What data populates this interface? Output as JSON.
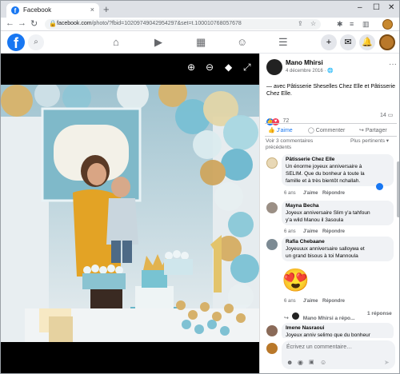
{
  "browser": {
    "tab_title": "Facebook",
    "tab_close": "×",
    "new_tab": "+",
    "url_host": "facebook.com",
    "url_path": "/photo/?fbid=1020974904295429​7&set=t.100010768057678",
    "win_min": "–",
    "win_max": "☐",
    "win_close": "✕",
    "back": "←",
    "forward": "→",
    "reload": "↻"
  },
  "fb": {
    "logo": "f",
    "search_icon": "search-icon",
    "plus": "+"
  },
  "post": {
    "author": "Mano Mhirsi",
    "date": "4 décembre 2016 · ",
    "body": "— avec Pâtisserie Sheselles Chez Elle et Pâtisserie Chez Elle.",
    "reaction_count": "72",
    "comment_count": "14",
    "like_label": "J'aime",
    "comment_label": "Commenter",
    "share_label": "Partager",
    "see_previous": "Voir 3 commentaires précédents",
    "sort_label": "Plus pertinents ▾"
  },
  "comments": [
    {
      "name": "Pâtisserie Chez Elle",
      "lines": [
        "Un énorme joyeux anniversaire à",
        "SELIM. Que du bonheur à toute la",
        "famille et à très bientôt nchallah."
      ],
      "age": "6 ans",
      "like": "J'aime",
      "reply": "Répondre"
    },
    {
      "name": "Mayna Becha",
      "lines": [
        "Joyeux anniversaire Slim y'a tahfoun",
        "y'a wild Manou il 3asoula"
      ],
      "age": "6 ans",
      "like": "J'aime",
      "reply": "Répondre"
    },
    {
      "name": "Rafia Chebaane",
      "lines": [
        "Joyeuuux anniversaire salloума et",
        "un grand bisous à toi Mannoula"
      ],
      "age": "6 ans",
      "like": "J'aime",
      "reply": "Répondre"
    },
    {
      "emoji": "😍",
      "age": "6 ans",
      "like": "J'aime",
      "reply": "Répondre"
    },
    {
      "name": "Imene Nasraoui",
      "lines": [
        "Joyeux anniv selimo que du bonheur"
      ]
    }
  ],
  "reply_link": {
    "author": "Mano Mhirsi a répo...",
    "count": "1 réponse"
  },
  "composer": {
    "placeholder": "Écrivez un commentaire…"
  }
}
